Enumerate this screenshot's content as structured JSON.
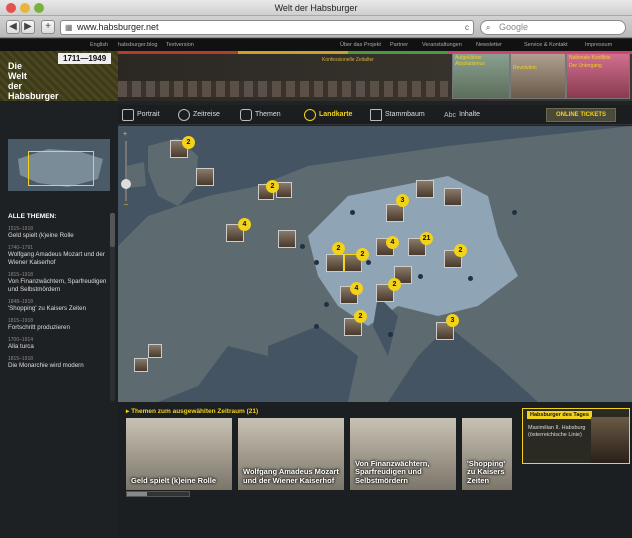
{
  "window": {
    "title": "Welt der Habsburger"
  },
  "toolbar": {
    "back": "◀",
    "forward": "▶",
    "add": "+",
    "url": "www.habsburger.net",
    "reload": "c",
    "search_placeholder": "Google"
  },
  "topnav": {
    "left": [
      "English",
      "habsburger.blog",
      "Textversion"
    ],
    "right": [
      "Über das Projekt",
      "Partner",
      "Veranstaltungen",
      "Newsletter",
      "Service & Kontakt",
      "Impressum"
    ]
  },
  "logo": {
    "years": "1711—1949",
    "line1": "Die",
    "line2": "Welt",
    "line3": "der",
    "line4": "Habsburger"
  },
  "timeline_labels": [
    "Konfessionelle Zeitalter",
    "Aufgeklärter Absolutismus",
    "Nationale Konflikte",
    "Revolution",
    "Der Untergang"
  ],
  "tabs": [
    {
      "label": "Portrait"
    },
    {
      "label": "Zeitreise"
    },
    {
      "label": "Themen"
    },
    {
      "label": "Landkarte"
    },
    {
      "label": "Stammbaum"
    },
    {
      "label": "Inhalte"
    }
  ],
  "tickets": "ONLINE TICKETS",
  "sidebar": {
    "heading": "ALLE THEMEN:",
    "items": [
      {
        "years": "1515–1918",
        "title": "Geld spielt (k)eine Rolle"
      },
      {
        "years": "1740–1791",
        "title": "Wolfgang Amadeus Mozart und der Wiener Kaiserhof"
      },
      {
        "years": "1815–1918",
        "title": "Von Finanzwächtern, Sparfreudigen und Selbstmördern"
      },
      {
        "years": "1848–1918",
        "title": "'Shopping' zu Kaisers Zeiten"
      },
      {
        "years": "1815–1918",
        "title": "Fortschritt produzieren"
      },
      {
        "years": "1700–1914",
        "title": "Alla turca"
      },
      {
        "years": "1815–1918",
        "title": "Die Monarchie wird modern"
      }
    ]
  },
  "map": {
    "badges": [
      "2",
      "2",
      "3",
      "4",
      "2",
      "2",
      "4",
      "21",
      "2",
      "2",
      "4",
      "2",
      "3",
      "4",
      "2"
    ]
  },
  "bottom": {
    "title": "▸ Themen zum ausgewählten Zeitraum (21)",
    "thumbs": [
      {
        "caption": "Geld spielt (k)eine Rolle"
      },
      {
        "caption": "Wolfgang Amadeus Mozart und der Wiener Kaiserhof"
      },
      {
        "caption": "Von Finanzwächtern, Sparfreudigen und Selbstmördern"
      },
      {
        "caption": "'Shopping' zu Kaisers Zeiten"
      }
    ],
    "daybox_header": "Habsburger des Tages",
    "daybox_name": "Maximilian II. Habsburg (österreichische Linie)"
  }
}
